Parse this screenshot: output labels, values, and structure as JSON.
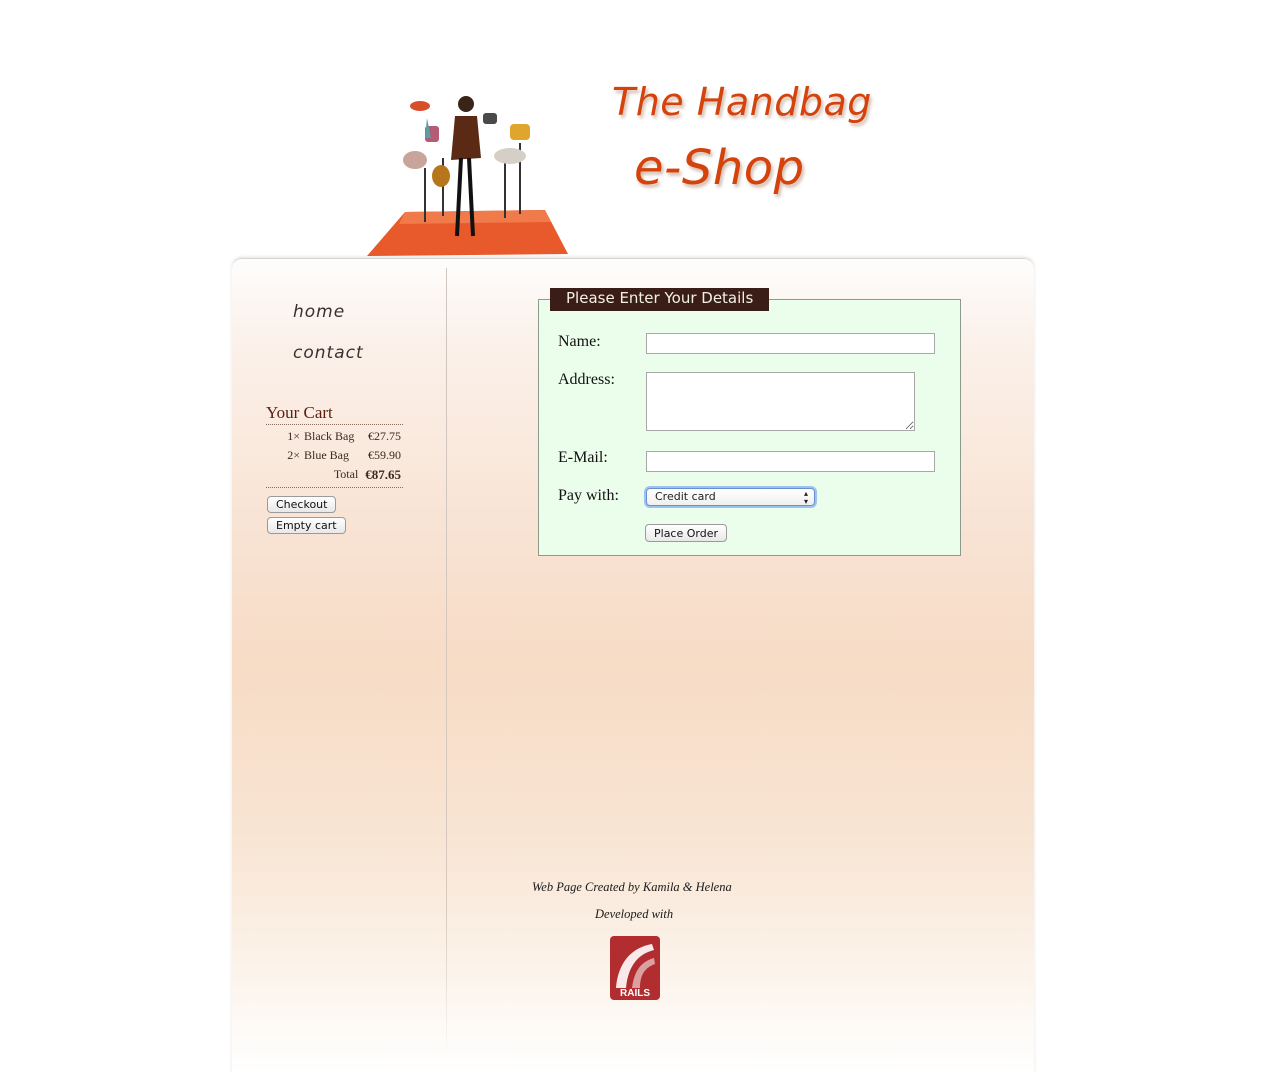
{
  "header": {
    "title_line1": "The Handbag",
    "title_line2": "e-Shop"
  },
  "nav": {
    "home": "home",
    "contact": "contact"
  },
  "cart": {
    "title": "Your Cart",
    "items": [
      {
        "qty": "1×",
        "name": "Black Bag",
        "price": "€27.75"
      },
      {
        "qty": "2×",
        "name": "Blue Bag",
        "price": "€59.90"
      }
    ],
    "total_label": "Total",
    "total_value": "€87.65",
    "checkout_label": "Checkout",
    "empty_label": "Empty cart"
  },
  "form": {
    "legend": "Please Enter Your Details",
    "name_label": "Name:",
    "name_value": "",
    "address_label": "Address:",
    "address_value": "",
    "email_label": "E-Mail:",
    "email_value": "",
    "pay_label": "Pay with:",
    "pay_selected": "Credit card",
    "submit_label": "Place Order"
  },
  "footer": {
    "credit": "Web Page Created by Kamila & Helena",
    "developed": "Developed with",
    "logo_text": "RAILS"
  },
  "colors": {
    "brand_orange": "#d6420c",
    "legend_bg": "#3b1d17",
    "form_bg": "#ebfdeb",
    "rails_red": "#b22d2f"
  }
}
